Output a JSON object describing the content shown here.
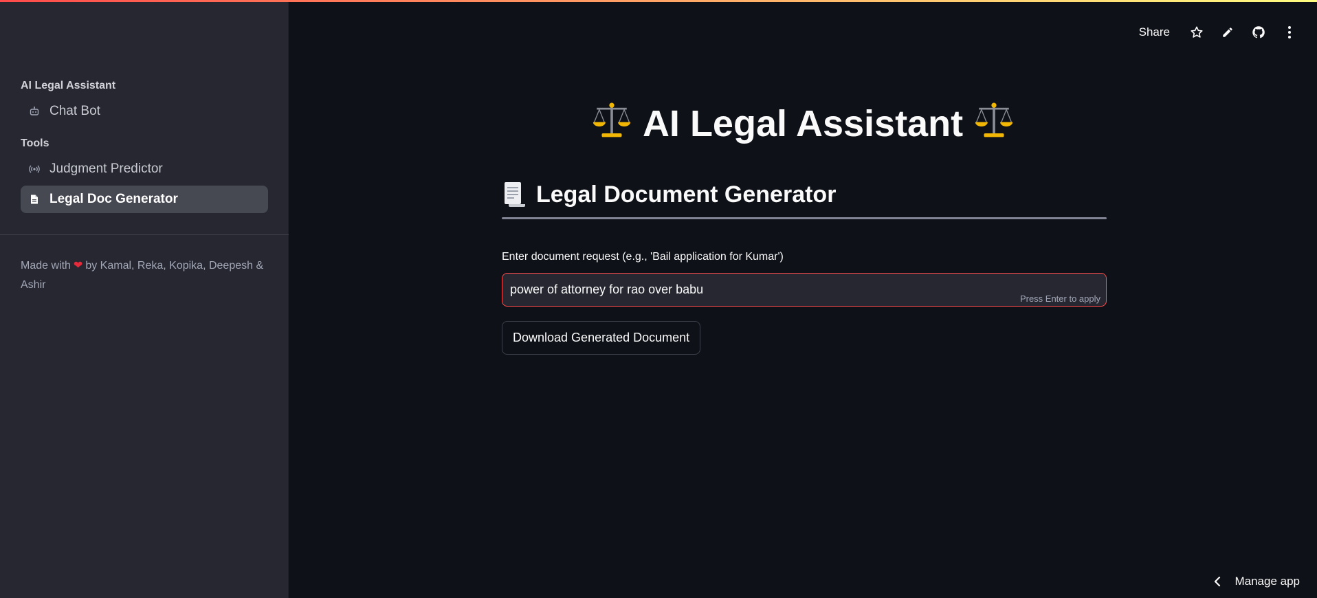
{
  "sidebar": {
    "sections": [
      {
        "label": "AI Legal Assistant",
        "items": [
          {
            "label": "Chat Bot",
            "icon": "robot-icon"
          }
        ]
      },
      {
        "label": "Tools",
        "items": [
          {
            "label": "Judgment Predictor",
            "icon": "broadcast-icon"
          },
          {
            "label": "Legal Doc Generator",
            "icon": "document-icon",
            "active": true
          }
        ]
      }
    ],
    "credits": {
      "prefix": "Made with",
      "suffix": "by Kamal, Reka, Kopika, Deepesh & Ashir"
    }
  },
  "toolbar": {
    "share_label": "Share",
    "icons": [
      "star-icon",
      "pencil-icon",
      "github-icon",
      "more-vertical-icon"
    ]
  },
  "main": {
    "title": "AI Legal Assistant",
    "title_emoji": "⚖️",
    "section_title": "Legal Document Generator",
    "section_emoji_icon": "scroll-icon",
    "input": {
      "label": "Enter document request (e.g., 'Bail application for Kumar')",
      "value": "power of attorney for rao over babu",
      "hint": "Press Enter to apply"
    },
    "download_label": "Download Generated Document"
  },
  "footer": {
    "manage_label": "Manage app"
  },
  "colors": {
    "background": "#0e1117",
    "sidebar": "#262730",
    "accent": "#ff4b4b",
    "active_item": "#464852"
  }
}
